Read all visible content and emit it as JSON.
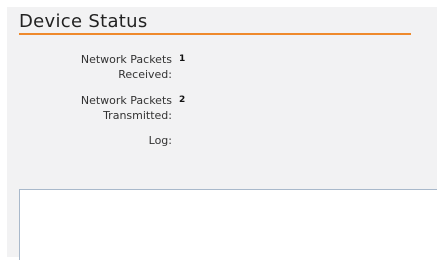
{
  "page": {
    "title": "Device Status"
  },
  "fields": [
    {
      "label": "Network Packets Received:",
      "value": "1"
    },
    {
      "label": "Network Packets Transmitted:",
      "value": "2"
    },
    {
      "label": "Log:",
      "value": ""
    }
  ],
  "log": {
    "content": ""
  },
  "colors": {
    "accent": "#ef8a2c",
    "panel_background": "#f2f2f3",
    "log_border": "#a9b9cb"
  }
}
